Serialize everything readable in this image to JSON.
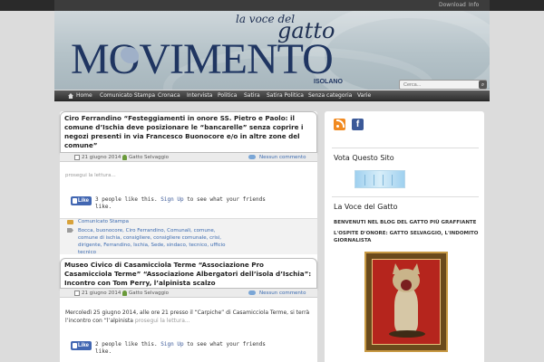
{
  "topbar": {
    "download": "Download",
    "info": "Info"
  },
  "header": {
    "tagline_top": "la voce del",
    "tagline_main": "gatto",
    "logo": "MOVIMENTO",
    "logo_sub": "ISOLANO",
    "search_placeholder": "Cerca..."
  },
  "nav": {
    "items": [
      "Home",
      "Comunicato Stampa",
      "Cronaca",
      "Intervista",
      "Politica",
      "Satira",
      "Satira Politica",
      "Senza categoria",
      "Varie"
    ]
  },
  "posts": [
    {
      "title": "Ciro Ferrandino “Festeggiamenti in onore SS. Pietro e Paolo: il comune d’Ischia deve posizionare le “bancarelle” senza coprire i negozi presenti in via Francesco Buonocore e/o in altre zone del comune”",
      "date": "21 giugno 2014",
      "author": "Gatto Selvaggio",
      "comments": "Nessun commento",
      "readmore": "prosegui la lettura...",
      "fb_like": "Like",
      "fb_count": "3 people like this.",
      "fb_signup": "Sign Up",
      "fb_rest": "to see what your friends like.",
      "category": "Comunicato Stampa",
      "tags": "Bocca, buonocore, Ciro Ferrandino, Comunali, comune, comune di ischia, consigliere, consigliere comunale, crisi, dirigente, Ferrandino, Ischia, Sede, sindaco, tecnico, ufficio tecnico"
    },
    {
      "title": "Museo Civico di Casamicciola Terme “Associazione Pro Casamicciola Terme” “Associazione Albergatori dell’isola d’Ischia”: Incontro con Tom Perry, l’alpinista scalzo",
      "date": "21 giugno 2014",
      "author": "Gatto Selvaggio",
      "comments": "Nessun commento",
      "excerpt": "Mercoledì 25 giugno 2014, alle ore 21 presso il “Carpiche” di Casamicciola Terme, si terrà l’incontro con “l’alpinista",
      "readmore": "prosegui la lettura...",
      "fb_like": "Like",
      "fb_count": "2 people like this.",
      "fb_signup": "Sign Up",
      "fb_rest": "to see what your friends like."
    }
  ],
  "sidebar": {
    "vote_title": "Vota Questo Sito",
    "voice_title": "La Voce del Gatto",
    "welcome": "BENVENUTI NEL BLOG DEL GATTO PIÙ GRAFFIANTE",
    "guest": "L'OSPITE D'ONORE: GATTO SELVAGGIO, L'INDOMITO GIORNALISTA"
  }
}
